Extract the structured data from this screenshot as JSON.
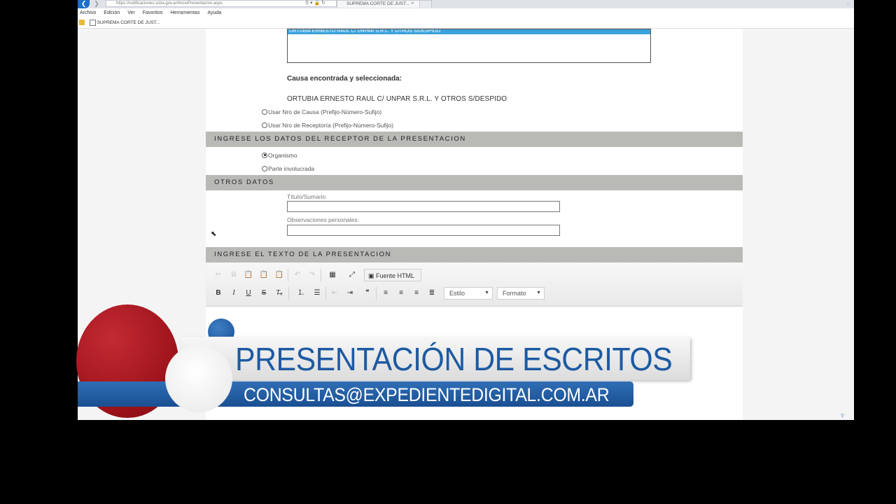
{
  "browser": {
    "address": "https://notificaciones.scba.gov.ar/InicioPresentacion.aspx",
    "tab_title": "SUPREMA CORTE DE JUST...",
    "menu": [
      "Archivo",
      "Edición",
      "Ver",
      "Favoritos",
      "Herramientas",
      "Ayuda"
    ],
    "favorite": "SUPREMA CORTE DE JUST..."
  },
  "causa": {
    "selected_row": "ORTUBIA ERNESTO RAUL C/ UNPAR S.R.L. Y OTROS S/DESPIDO",
    "found_title": "Causa encontrada y seleccionada:",
    "found_value": "ORTUBIA ERNESTO RAUL C/ UNPAR S.R.L. Y OTROS S/DESPIDO",
    "option_nro_causa": "Usar Nro de Causa (Prefijo-Número-Sufijo)",
    "option_nro_receptoria": "Usar Nro de Receptoría (Prefijo-Número-Sufijo)"
  },
  "receptor": {
    "header": "INGRESE LOS DATOS DEL RECEPTOR DE LA PRESENTACION",
    "option_organismo": "Organismo",
    "option_parte": "Parte involucrada"
  },
  "otros": {
    "header": "OTROS DATOS",
    "titulo_label": "Título/Sumario",
    "titulo_value": "",
    "observaciones_label": "Observaciones personales:",
    "observaciones_value": ""
  },
  "texto": {
    "header": "INGRESE EL TEXTO DE LA PRESENTACION",
    "source_label": "Fuente HTML",
    "estilo_label": "Estilo",
    "formato_label": "Formato"
  },
  "overlay": {
    "title": "PRESENTACIÓN DE ESCRITOS",
    "email": "CONSULTAS@EXPEDIENTEDIGITAL.COM.AR"
  },
  "colors": {
    "section_header": "#b9b9b6",
    "selected_row": "#3aa1da",
    "overlay_blue": "#1d5aa2",
    "overlay_red": "#9a1119"
  }
}
